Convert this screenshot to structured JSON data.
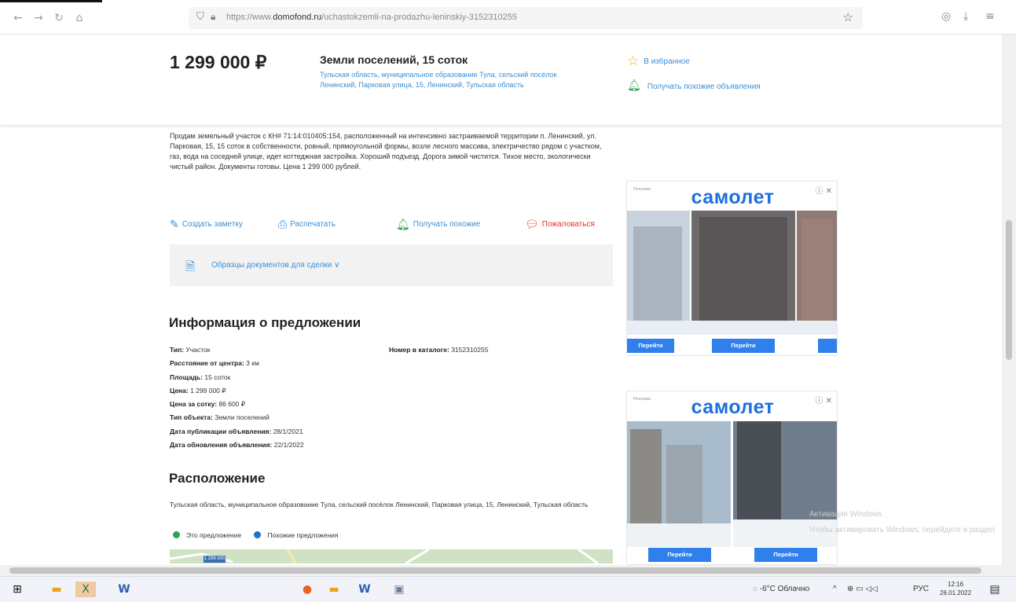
{
  "browser": {
    "url_prefix": "https://www.",
    "url_domain": "domofond.ru",
    "url_path": "/uchastokzemli-na-prodazhu-leninskiy-3152310255",
    "back_icon": "back-arrow-icon",
    "forward_icon": "forward-arrow-icon",
    "reload_icon": "reload-icon",
    "home_icon": "home-icon"
  },
  "header": {
    "price": "1 299 000 ₽",
    "title": "Земли поселений, 15 соток",
    "address": "Тульская область, муниципальное образование Тула, сельский посёлок Ленинский, Парковая улица, 15, Ленинский, Тульская область",
    "favorites_label": "В избранное",
    "similar_label": "Получать похожие объявления"
  },
  "description": "Продам земельный участок с КН# 71:14:010405:154, расположенный на интенсивно застраиваемой территории п. Ленинский, ул. Парковая, 15, 15 соток в собственности, ровный, прямоугольной формы, возле лесного массива, электричество рядом с участком, газ, вода на соседней улице, идет коттеджная застройка. Хороший подъезд. Дорога зимой чистится. Тихое место, экологически чистый район. Документы готовы. Цена 1 299 000 рублей.",
  "actions": {
    "note": "Создать заметку",
    "print": "Распечатать",
    "similar": "Получать похожие",
    "complain": "Пожаловаться"
  },
  "docs": {
    "label": "Образцы документов для сделки ∨"
  },
  "info": {
    "title": "Информация о предложении",
    "rows": [
      {
        "key": "Тип:",
        "value": " Участок"
      },
      {
        "key": "Расстояние от центра:",
        "value": " 3 км"
      },
      {
        "key": "Площадь:",
        "value": " 15 соток"
      },
      {
        "key": "Цена:",
        "value": " 1 299 000 ₽"
      },
      {
        "key": "Цена за сотку:",
        "value": " 86 600 ₽"
      },
      {
        "key": "Тип объекта:",
        "value": " Земли поселений"
      },
      {
        "key": "Дата публикации объявления:",
        "value": " 28/1/2021"
      },
      {
        "key": "Дата обновления объявления:",
        "value": " 22/1/2022"
      }
    ],
    "catalog_key": "Номер в каталоге:",
    "catalog_value": " 3152310255"
  },
  "location": {
    "title": "Расположение",
    "address": "Тульская область, муниципальное образование Тула, сельский посёлок Ленинский, Парковая улица, 15, Ленинский, Тульская область",
    "legend_this": "Это предложение",
    "legend_similar": "Похожие предложения",
    "map_pin": "1 299 000"
  },
  "ads": [
    {
      "label": "Реклама",
      "brand": "самолет",
      "button": "Перейти"
    },
    {
      "label": "Реклама",
      "brand": "самолет",
      "button": "Перейти"
    }
  ],
  "watermark": {
    "line1": "Активация Windows",
    "line2": "Чтобы активировать Windows, перейдите в раздел"
  },
  "taskbar": {
    "weather": "-6°C Облачно",
    "lang": "РУС",
    "time": "12:16",
    "date": "26.01.2022"
  },
  "colors": {
    "link": "#3b8fd6",
    "favorite_star": "#f2b400",
    "similar_green": "#2aa455",
    "complain_red": "#e0342c",
    "legend_this": "#2aa455",
    "legend_similar": "#1a73c8",
    "ad_brand": "#1d6fe0",
    "ad_button": "#2f80ed"
  }
}
